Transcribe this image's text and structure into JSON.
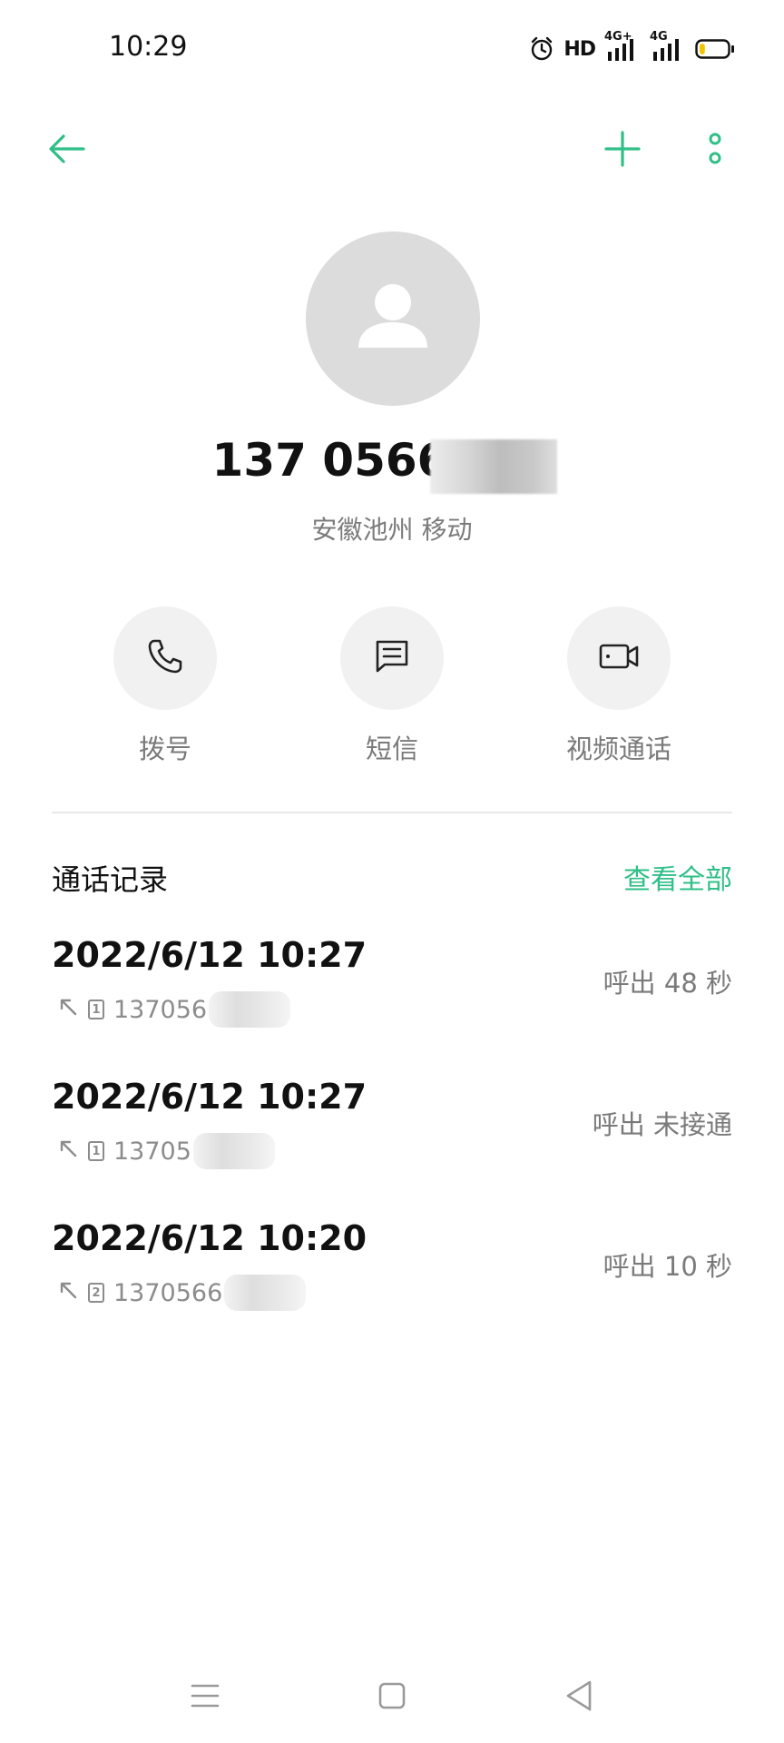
{
  "status_bar": {
    "time": "10:29",
    "hd_label": "HD",
    "net1_label": "4G+",
    "net2_label": "4G",
    "battery_level": 0.2,
    "icons": [
      "alarm-icon",
      "hd-icon",
      "signal-icon",
      "signal-icon",
      "battery-icon"
    ]
  },
  "top_bar": {
    "icons": [
      "back-arrow-icon",
      "add-icon",
      "more-vertical-icon"
    ]
  },
  "contact": {
    "number": "137 0566",
    "location": "安徽池州 移动",
    "avatar_icon": "person-icon"
  },
  "actions": [
    {
      "label": "拨号",
      "icon": "phone-icon"
    },
    {
      "label": "短信",
      "icon": "message-icon"
    },
    {
      "label": "视频通话",
      "icon": "video-icon"
    }
  ],
  "call_log": {
    "title": "通话记录",
    "view_all": "查看全部",
    "items": [
      {
        "datetime": "2022/6/12 10:27",
        "sim": "1",
        "number": "137056",
        "status": "呼出  48 秒"
      },
      {
        "datetime": "2022/6/12 10:27",
        "sim": "1",
        "number": "13705",
        "status": "呼出 未接通"
      },
      {
        "datetime": "2022/6/12 10:20",
        "sim": "2",
        "number": "1370566",
        "status": "呼出  10 秒"
      }
    ]
  },
  "nav_bar": {
    "icons": [
      "menu-icon",
      "home-icon",
      "back-icon"
    ]
  },
  "colors": {
    "accent": "#2fbf87",
    "avatar_bg": "#dcdcdc",
    "action_bg": "#f1f1f1",
    "secondary_text": "#7a7a7a"
  }
}
